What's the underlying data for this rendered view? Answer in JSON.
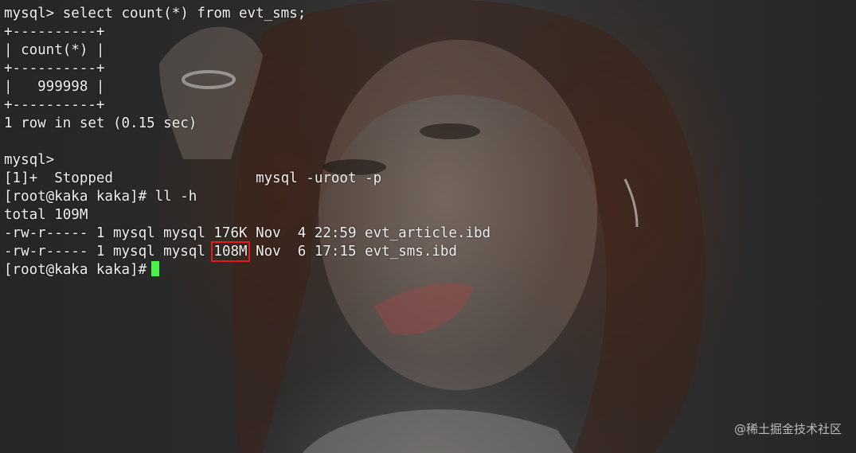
{
  "terminal": {
    "prompt_lines": [
      "mysql> select count(*) from evt_sms;",
      "+----------+",
      "| count(*) |",
      "+----------+",
      "|   999998 |",
      "+----------+",
      "1 row in set (0.15 sec)",
      "",
      "mysql>",
      "[1]+  Stopped                 mysql -uroot -p",
      "[root@kaka kaka]# ll -h",
      "total 109M",
      "-rw-r----- 1 mysql mysql 176K Nov  4 22:59 evt_article.ibd"
    ],
    "last_file_line": {
      "before": "-rw-r----- 1 mysql mysql ",
      "size": "108M",
      "after": " Nov  6 17:15 evt_sms.ibd"
    },
    "final_prompt": "[root@kaka kaka]#",
    "cursor_color": "#4cf04c",
    "highlight_color": "#e31b1b"
  },
  "watermark": "@稀土掘金技术社区"
}
